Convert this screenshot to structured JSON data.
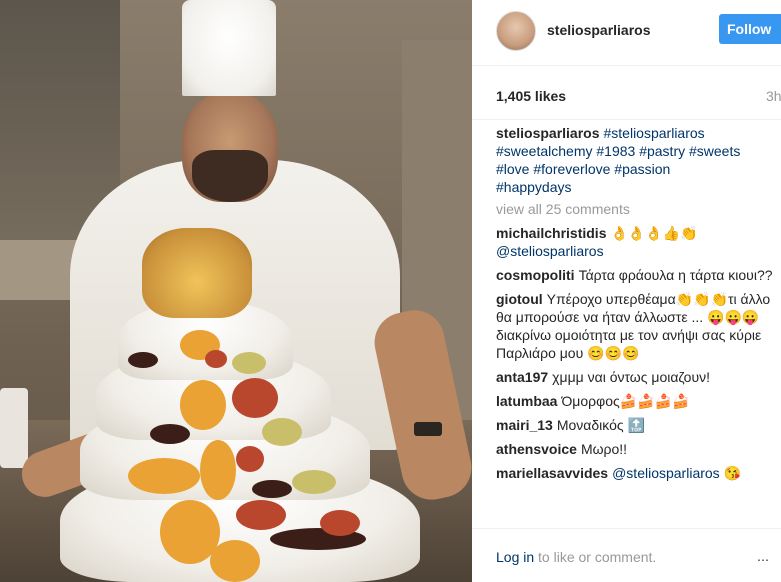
{
  "post": {
    "username": "steliosparliaros",
    "follow_label": "Follow",
    "likes": "1,405 likes",
    "time": "3h"
  },
  "caption": {
    "username": "steliosparliaros",
    "tags_line1": "#steliosparliaros",
    "tags_line2": "#sweetalchemy #1983 #pastry #sweets",
    "tags_line3": "#love #foreverlove #passion",
    "tags_line4": "#happydays"
  },
  "view_all": "view all 25 comments",
  "comments": [
    {
      "user": "michailchristidis",
      "text": "👌👌👌👍👏",
      "mention": "@steliosparliaros"
    },
    {
      "user": "cosmopoliti",
      "text": "Τάρτα φράουλα η τάρτα κιουι??"
    },
    {
      "user": "giotoul",
      "text": "Υπέροχο υπερθέαμα👏👏👏τι άλλο θα μπορούσε να ήταν άλλωστε ... 😛😛😛διακρίνω ομοιότητα με τον ανήψι σας κύριε Παρλιάρο μου 😊😊😊"
    },
    {
      "user": "anta197",
      "text": "χμμμ ναι όντως μοιαζουν!"
    },
    {
      "user": "latumbaa",
      "text": "Όμορφος🍰🍰🍰🍰"
    },
    {
      "user": "mairi_13",
      "text": "Μοναδικός 🔝"
    },
    {
      "user": "athensvoice",
      "text": "Μωρο!!"
    },
    {
      "user": "mariellasavvides",
      "text": "",
      "mention": "@steliosparliaros 😘"
    }
  ],
  "footer": {
    "login_link": "Log in",
    "login_rest": " to like or comment.",
    "more": "⋯"
  }
}
